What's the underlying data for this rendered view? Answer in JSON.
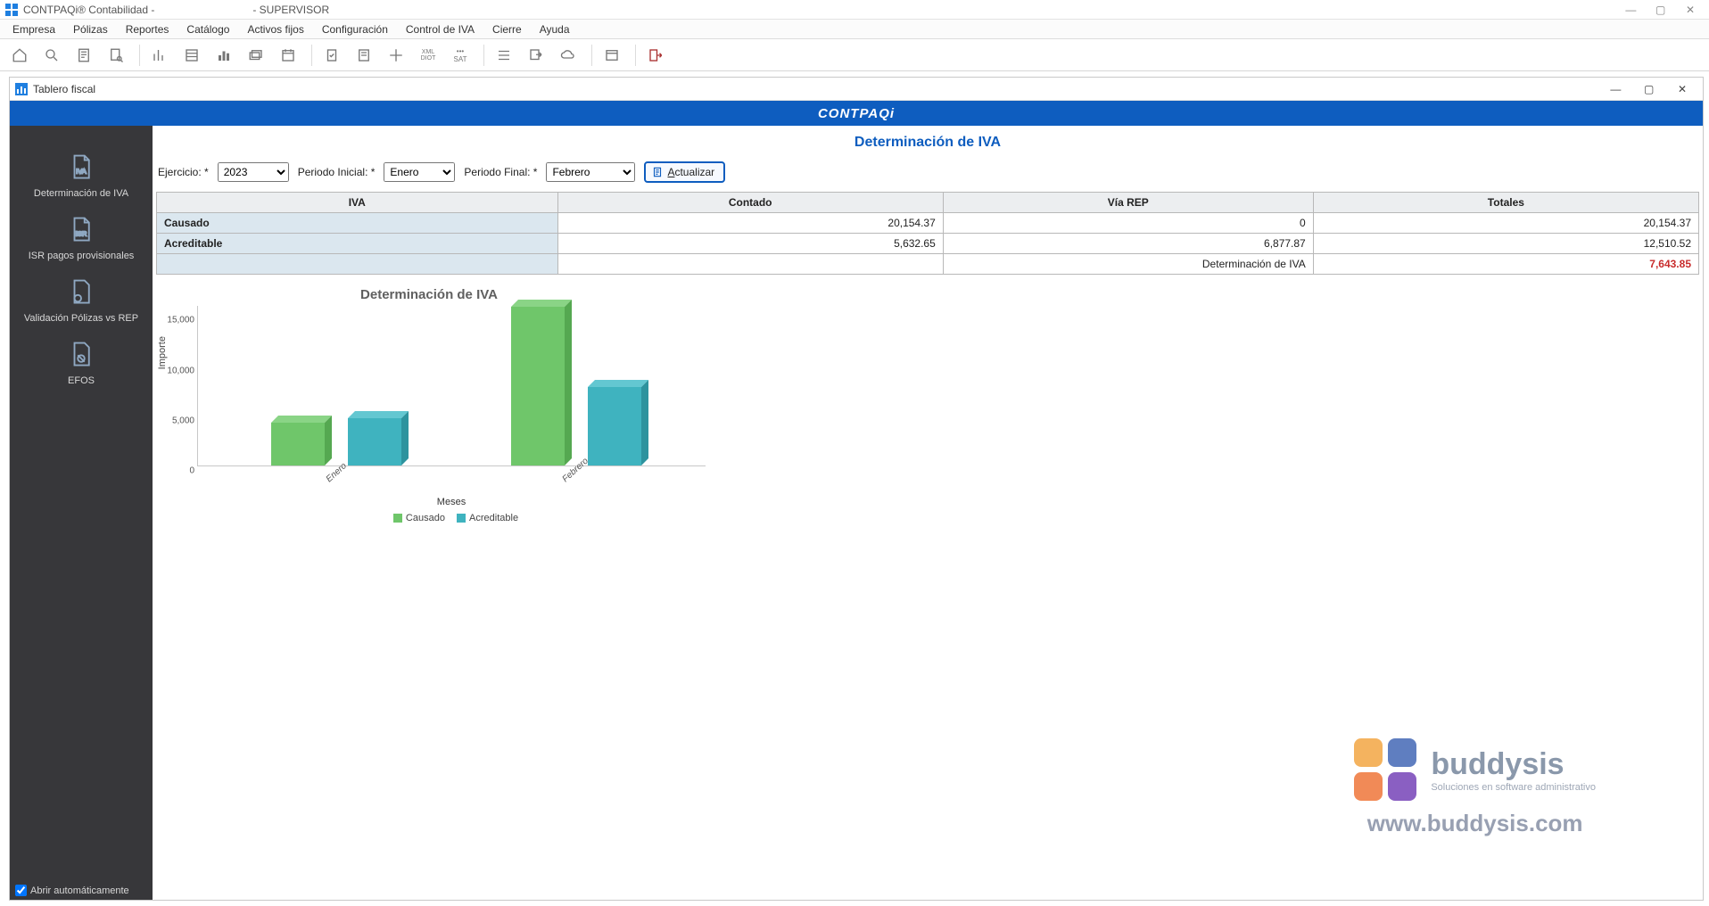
{
  "app": {
    "title": "CONTPAQi® Contabilidad -",
    "user_suffix": "- SUPERVISOR"
  },
  "menu": [
    "Empresa",
    "Pólizas",
    "Reportes",
    "Catálogo",
    "Activos fijos",
    "Configuración",
    "Control de IVA",
    "Cierre",
    "Ayuda"
  ],
  "inner": {
    "title": "Tablero fiscal",
    "brand": "CONTPAQi"
  },
  "sidebar": {
    "items": [
      {
        "label": "Determinación de IVA"
      },
      {
        "label": "ISR pagos provisionales"
      },
      {
        "label": "Validación Pólizas vs REP"
      },
      {
        "label": "EFOS"
      }
    ],
    "footer_label": "Abrir automáticamente",
    "footer_checked": true
  },
  "page": {
    "title": "Determinación de IVA",
    "filters": {
      "ejercicio_label": "Ejercicio: *",
      "ejercicio_value": "2023",
      "pinicial_label": "Periodo Inicial: *",
      "pinicial_value": "Enero",
      "pfinal_label": "Periodo Final: *",
      "pfinal_value": "Febrero",
      "update_label": "Actualizar"
    },
    "table": {
      "headers": [
        "IVA",
        "Contado",
        "Vía REP",
        "Totales"
      ],
      "rows": [
        {
          "label": "Causado",
          "contado": "20,154.37",
          "rep": "0",
          "total": "20,154.37"
        },
        {
          "label": "Acreditable",
          "contado": "5,632.65",
          "rep": "6,877.87",
          "total": "12,510.52"
        }
      ],
      "footer_label": "Determinación de IVA",
      "footer_value": "7,643.85"
    }
  },
  "chart_data": {
    "type": "bar",
    "title": "Determinación de IVA",
    "xlabel": "Meses",
    "ylabel": "Importe",
    "categories": [
      "Enero",
      "Febrero"
    ],
    "series": [
      {
        "name": "Causado",
        "color": "#6fc66a",
        "values": [
          4300,
          15800
        ]
      },
      {
        "name": "Acreditable",
        "color": "#3fb3bf",
        "values": [
          4700,
          7800
        ]
      }
    ],
    "yticks": [
      0,
      5000,
      10000,
      15000
    ],
    "ylim": [
      0,
      16000
    ]
  },
  "watermark": {
    "name": "buddysis",
    "tag": "Soluciones en software administrativo",
    "url": "www.buddysis.com"
  }
}
